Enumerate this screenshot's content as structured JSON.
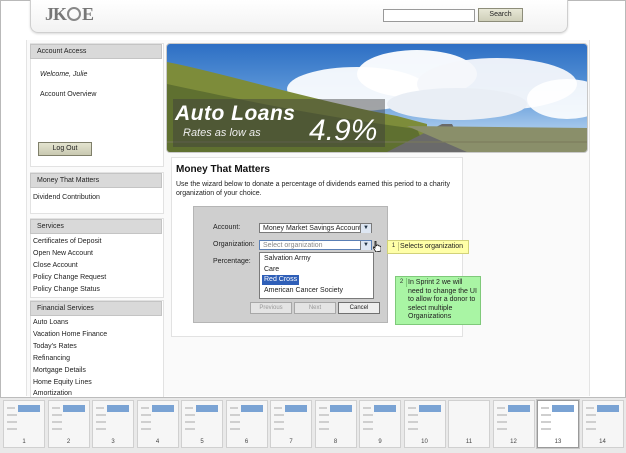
{
  "header": {
    "logo_text": "JK",
    "logo_tail": "E",
    "search_placeholder": "",
    "search_button": "Search"
  },
  "sidebar": {
    "account_access": {
      "title": "Account Access",
      "welcome": "Welcome, Julie",
      "overview": "Account Overview",
      "logout": "Log Out"
    },
    "money_matters": {
      "title": "Money That Matters",
      "items": [
        "Dividend Contribution"
      ]
    },
    "services": {
      "title": "Services",
      "items": [
        "Certificates of Deposit",
        "Open New Account",
        "Close Account",
        "Policy Change Request",
        "Policy Change Status"
      ]
    },
    "financial": {
      "title": "Financial Services",
      "items": [
        "Auto Loans",
        "Vacation Home Finance",
        "Today's Rates",
        "Refinancing",
        "Mortgage Details",
        "Home Equity Lines",
        "Amortization"
      ]
    }
  },
  "banner": {
    "line1": "Auto Loans",
    "line2": "Rates as low as",
    "rate": "4.9%"
  },
  "main": {
    "title": "Money That Matters",
    "description": "Use the wizard below to donate a percentage of dividends earned this period to a charity organization of your choice.",
    "wizard": {
      "account_label": "Account:",
      "account_value": "Money Market Savings Account",
      "org_label": "Organization:",
      "org_placeholder": "Select organization",
      "percentage_label": "Percentage:",
      "options": [
        "Salvation Army",
        "Care",
        "Red Cross",
        "American Cancer Society"
      ],
      "highlighted_index": 2,
      "buttons": {
        "previous": "Previous",
        "next": "Next",
        "cancel": "Cancel"
      }
    }
  },
  "annotations": [
    {
      "num": "1",
      "text": "Selects organization"
    },
    {
      "num": "2",
      "text": "In Sprint 2 we will need to change the UI to allow for a donor to select multiple Organizations"
    }
  ],
  "thumbnails": {
    "labels": [
      "1",
      "2",
      "3",
      "4",
      "5",
      "6",
      "7",
      "8",
      "9",
      "10",
      "11",
      "12",
      "13",
      "14"
    ],
    "active": "13"
  },
  "colors": {
    "annotation_yellow": "#ffffa8",
    "annotation_green": "#a9f5a4",
    "highlight": "#2f5fb8"
  }
}
